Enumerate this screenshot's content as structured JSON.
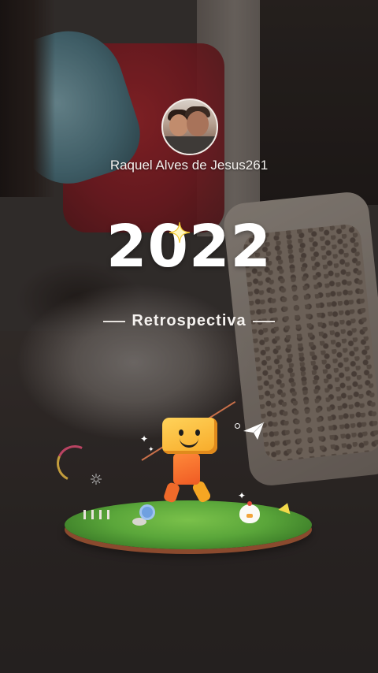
{
  "profile": {
    "username": "Raquel Alves de Jesus261"
  },
  "recap": {
    "year": "2022",
    "subtitle": "Retrospectiva"
  },
  "icons": {
    "sparkle": "sparkle-icon",
    "paper_plane": "paper-plane-icon",
    "mascot": "box-robot-mascot"
  },
  "colors": {
    "accent_star": "#f7e36b",
    "mascot_head": "#ffc53d",
    "mascot_body": "#ef6a2a",
    "grass": "#5aa63a"
  }
}
